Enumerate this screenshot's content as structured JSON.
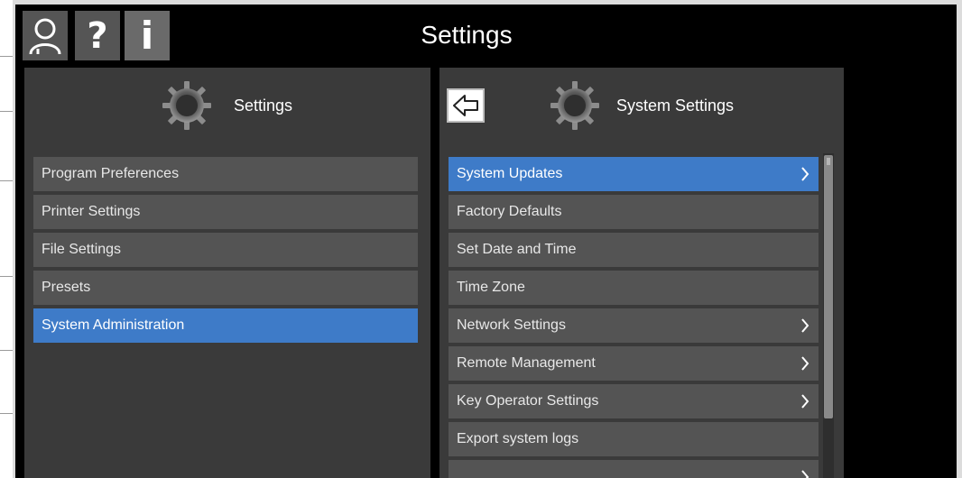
{
  "window": {
    "title": "Settings"
  },
  "topbar": {
    "icons": [
      "user-icon",
      "help-icon",
      "info-icon"
    ],
    "help_glyph": "?",
    "info_glyph": "i"
  },
  "left_panel": {
    "title": "Settings",
    "icon": "gear-icon",
    "items": [
      {
        "label": "Program Preferences"
      },
      {
        "label": "Printer Settings"
      },
      {
        "label": "File Settings"
      },
      {
        "label": "Presets"
      },
      {
        "label": "System Administration",
        "selected": true
      }
    ]
  },
  "right_panel": {
    "title": "System Settings",
    "icon": "gear-icon",
    "back_icon": "back-arrow-icon",
    "items": [
      {
        "label": "System Updates",
        "selected": true,
        "has_submenu": true
      },
      {
        "label": "Factory Defaults"
      },
      {
        "label": "Set Date and Time"
      },
      {
        "label": "Time Zone"
      },
      {
        "label": "Network Settings",
        "has_submenu": true
      },
      {
        "label": "Remote Management",
        "has_submenu": true
      },
      {
        "label": "Key Operator Settings",
        "has_submenu": true
      },
      {
        "label": "Export system logs"
      }
    ]
  },
  "colors": {
    "background": "#000000",
    "panel": "#3a3a3a",
    "item": "#545454",
    "selected": "#3e7bc8",
    "text": "#e8e8e8"
  }
}
